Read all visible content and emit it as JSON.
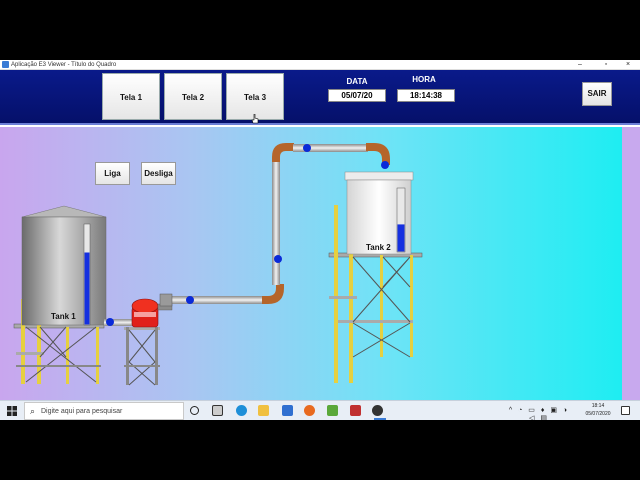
{
  "window": {
    "title": "Aplicação E3 Viewer - Título do Quadro",
    "controls": {
      "minimize": "–",
      "maximize": "▫",
      "close": "×"
    }
  },
  "header": {
    "nav": [
      {
        "label": "Tela 1"
      },
      {
        "label": "Tela 2"
      },
      {
        "label": "Tela 3"
      }
    ],
    "date_label": "DATA",
    "date_value": "05/07/20",
    "time_label": "HORA",
    "time_value": "18:14:38",
    "exit_label": "SAIR"
  },
  "controls": {
    "on_label": "Liga",
    "off_label": "Desliga"
  },
  "tanks": {
    "tank1": {
      "label": "Tank 1",
      "level": 0.72
    },
    "tank2": {
      "label": "Tank 2",
      "level": 0.43
    }
  },
  "colors": {
    "header_bg": "#0a1a8a",
    "pipe_copper": "#b5652a",
    "flow_dot": "#0a2ad8",
    "level_blue": "#1530e0",
    "pump_red": "#e0201a"
  },
  "taskbar": {
    "search_placeholder": "Digite aqui para pesquisar",
    "clock_time": "18:14",
    "clock_date": "05/07/2020"
  }
}
